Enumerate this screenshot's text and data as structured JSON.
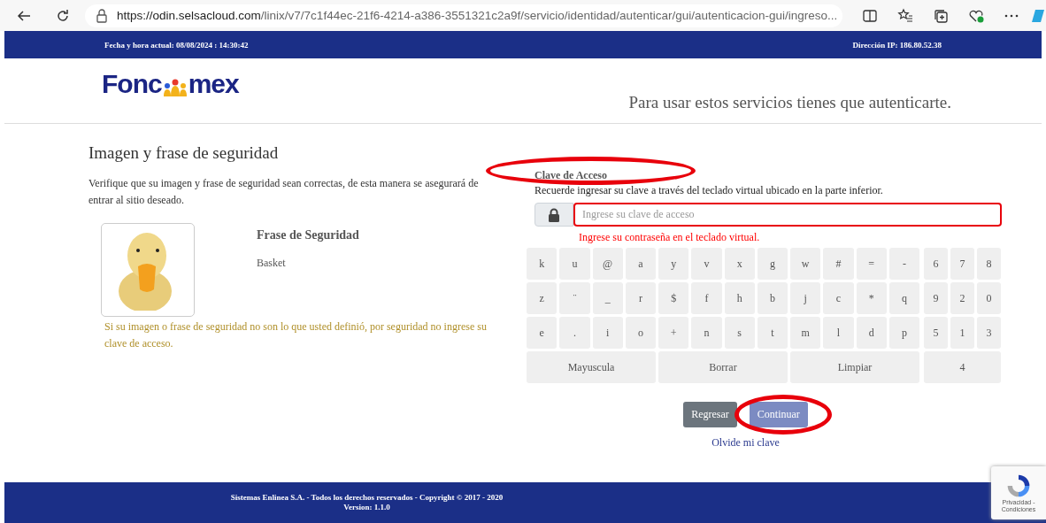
{
  "browser": {
    "url_host": "https://odin.selsacloud.com",
    "url_path": "/linix/v7/7c1f44ec-21f6-4214-a386-3551321c2a9f/servicio/identidad/autenticar/gui/autenticacion-gui/ingreso..."
  },
  "top_bar": {
    "datetime": "Fecha y hora actual: 08/08/2024 : 14:30:42",
    "ip": "Dirección IP: 186.80.52.38"
  },
  "header": {
    "logo_before": "Fonc",
    "logo_after": "mex",
    "tagline": "Para usar estos servicios tienes que autenticarte."
  },
  "security": {
    "title": "Imagen y frase de seguridad",
    "description": "Verifique que su imagen y frase de seguridad sean correctas, de esta manera se asegurará de entrar al sitio deseado.",
    "phrase_label": "Frase de Seguridad",
    "phrase": "Basket",
    "warning": "Si su imagen o frase de seguridad no son lo que usted definió, por seguridad no ingrese su clave de acceso."
  },
  "access": {
    "label": "Clave de Acceso",
    "label_circled": true,
    "hint": "Recuerde ingresar su clave a través del teclado virtual ubicado en la parte inferior.",
    "placeholder": "Ingrese su clave de acceso",
    "error": "Ingrese su contraseña en el teclado virtual.",
    "keyboard": {
      "letters": [
        [
          "k",
          "u",
          "@",
          "a",
          "y",
          "v",
          "x",
          "g",
          "w",
          "#",
          "=",
          "-"
        ],
        [
          "z",
          "¨",
          "_",
          "r",
          "$",
          "f",
          "h",
          "b",
          "j",
          "c",
          "*",
          "q"
        ],
        [
          "e",
          ".",
          "i",
          "o",
          "+",
          "n",
          "s",
          "t",
          "m",
          "l",
          "d",
          "p"
        ]
      ],
      "numbers": [
        [
          "6",
          "7",
          "8"
        ],
        [
          "9",
          "2",
          "0"
        ],
        [
          "5",
          "1",
          "3"
        ]
      ],
      "actions": [
        "Mayuscula",
        "Borrar",
        "Limpiar"
      ],
      "number_last": "4"
    }
  },
  "buttons": [
    {
      "label": "Regresar",
      "kind": "secondary",
      "circled": false
    },
    {
      "label": "Continuar",
      "kind": "primary",
      "circled": true
    }
  ],
  "forgot_link": "Olvide mi clave",
  "footer": {
    "copyright": "Sistemas Enlinea S.A. - Todos los derechos reservados - Copyright © 2017 - 2020",
    "version": "Version: 1.1.0"
  },
  "recaptcha": {
    "text": "Privacidad - Condiciones"
  }
}
